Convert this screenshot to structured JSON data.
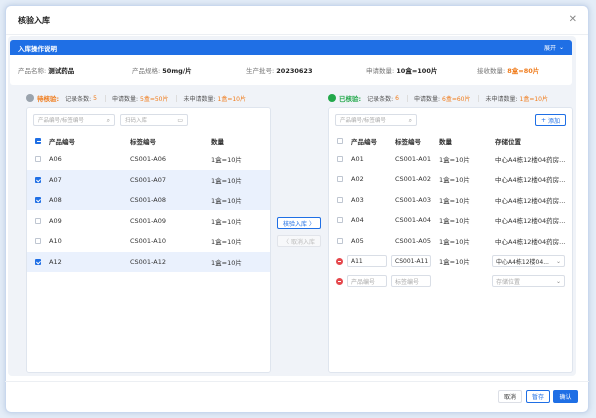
{
  "dialog": {
    "title": "核验入库"
  },
  "banner": {
    "title": "入库操作说明",
    "expand_label": "展开"
  },
  "info": {
    "product_name_label": "产品名称:",
    "product_name": "测试药品",
    "spec_label": "产品规格:",
    "spec": "50mg/片",
    "batch_label": "生产批号:",
    "batch": "20230623",
    "apply_qty_label": "申请数量:",
    "apply_qty": "10盒=100片",
    "recv_qty_label": "接收数量:",
    "recv_qty": "8盒=80片"
  },
  "pending": {
    "status": "待核验:",
    "record_label": "记录条数:",
    "record_count": "5",
    "apply_label": "申请数量:",
    "apply_qty": "5盒=50片",
    "not_apply_label": "未申请数量:",
    "not_apply_qty": "1盒=10片",
    "search_placeholder": "产品编号/标签编号",
    "scan_placeholder": "扫码入库",
    "columns": {
      "code": "产品编号",
      "tag": "标签编号",
      "qty": "数量"
    },
    "rows": [
      {
        "code": "A06",
        "tag": "CS001-A06",
        "qty": "1盒=10片",
        "checked": false
      },
      {
        "code": "A07",
        "tag": "CS001-A07",
        "qty": "1盒=10片",
        "checked": true
      },
      {
        "code": "A08",
        "tag": "CS001-A08",
        "qty": "1盒=10片",
        "checked": true
      },
      {
        "code": "A09",
        "tag": "CS001-A09",
        "qty": "1盒=10片",
        "checked": false
      },
      {
        "code": "A10",
        "tag": "CS001-A10",
        "qty": "1盒=10片",
        "checked": false
      },
      {
        "code": "A12",
        "tag": "CS001-A12",
        "qty": "1盒=10片",
        "checked": true
      }
    ]
  },
  "middle": {
    "verify_button": "核验入库 〉",
    "cancel_button": "〈 取消入库"
  },
  "verified": {
    "status": "已核验:",
    "record_label": "记录条数:",
    "record_count": "6",
    "apply_label": "申请数量:",
    "apply_qty": "6盒=60片",
    "not_apply_label": "未申请数量:",
    "not_apply_qty": "1盒=10片",
    "search_placeholder": "产品编号/标签编号",
    "add_button": "添加",
    "columns": {
      "code": "产品编号",
      "tag": "标签编号",
      "qty": "数量",
      "loc": "存储位置"
    },
    "rows": [
      {
        "code": "A01",
        "tag": "CS001-A01",
        "qty": "1盒=10片",
        "loc": "中心A4栋12楼04药房..."
      },
      {
        "code": "A02",
        "tag": "CS001-A02",
        "qty": "1盒=10片",
        "loc": "中心A4栋12楼04药房..."
      },
      {
        "code": "A03",
        "tag": "CS001-A03",
        "qty": "1盒=10片",
        "loc": "中心A4栋12楼04药房..."
      },
      {
        "code": "A04",
        "tag": "CS001-A04",
        "qty": "1盒=10片",
        "loc": "中心A4栋12楼04药房..."
      },
      {
        "code": "A05",
        "tag": "CS001-A05",
        "qty": "1盒=10片",
        "loc": "中心A4栋12楼04药房..."
      }
    ],
    "edit_row": {
      "code": "A11",
      "tag": "CS001-A11",
      "qty": "1盒=10片",
      "loc": "中心A4栋12楼04..."
    },
    "new_row": {
      "code_placeholder": "产品编号",
      "tag_placeholder": "标签编号",
      "loc_placeholder": "存储位置"
    }
  },
  "footer": {
    "cancel": "取消",
    "save": "暂存",
    "confirm": "确认"
  },
  "colors": {
    "primary": "#1f6fe5",
    "orange": "#f07c1c",
    "green": "#22a84a",
    "gray_icon": "#9aa3ad",
    "danger": "#e5484d"
  }
}
